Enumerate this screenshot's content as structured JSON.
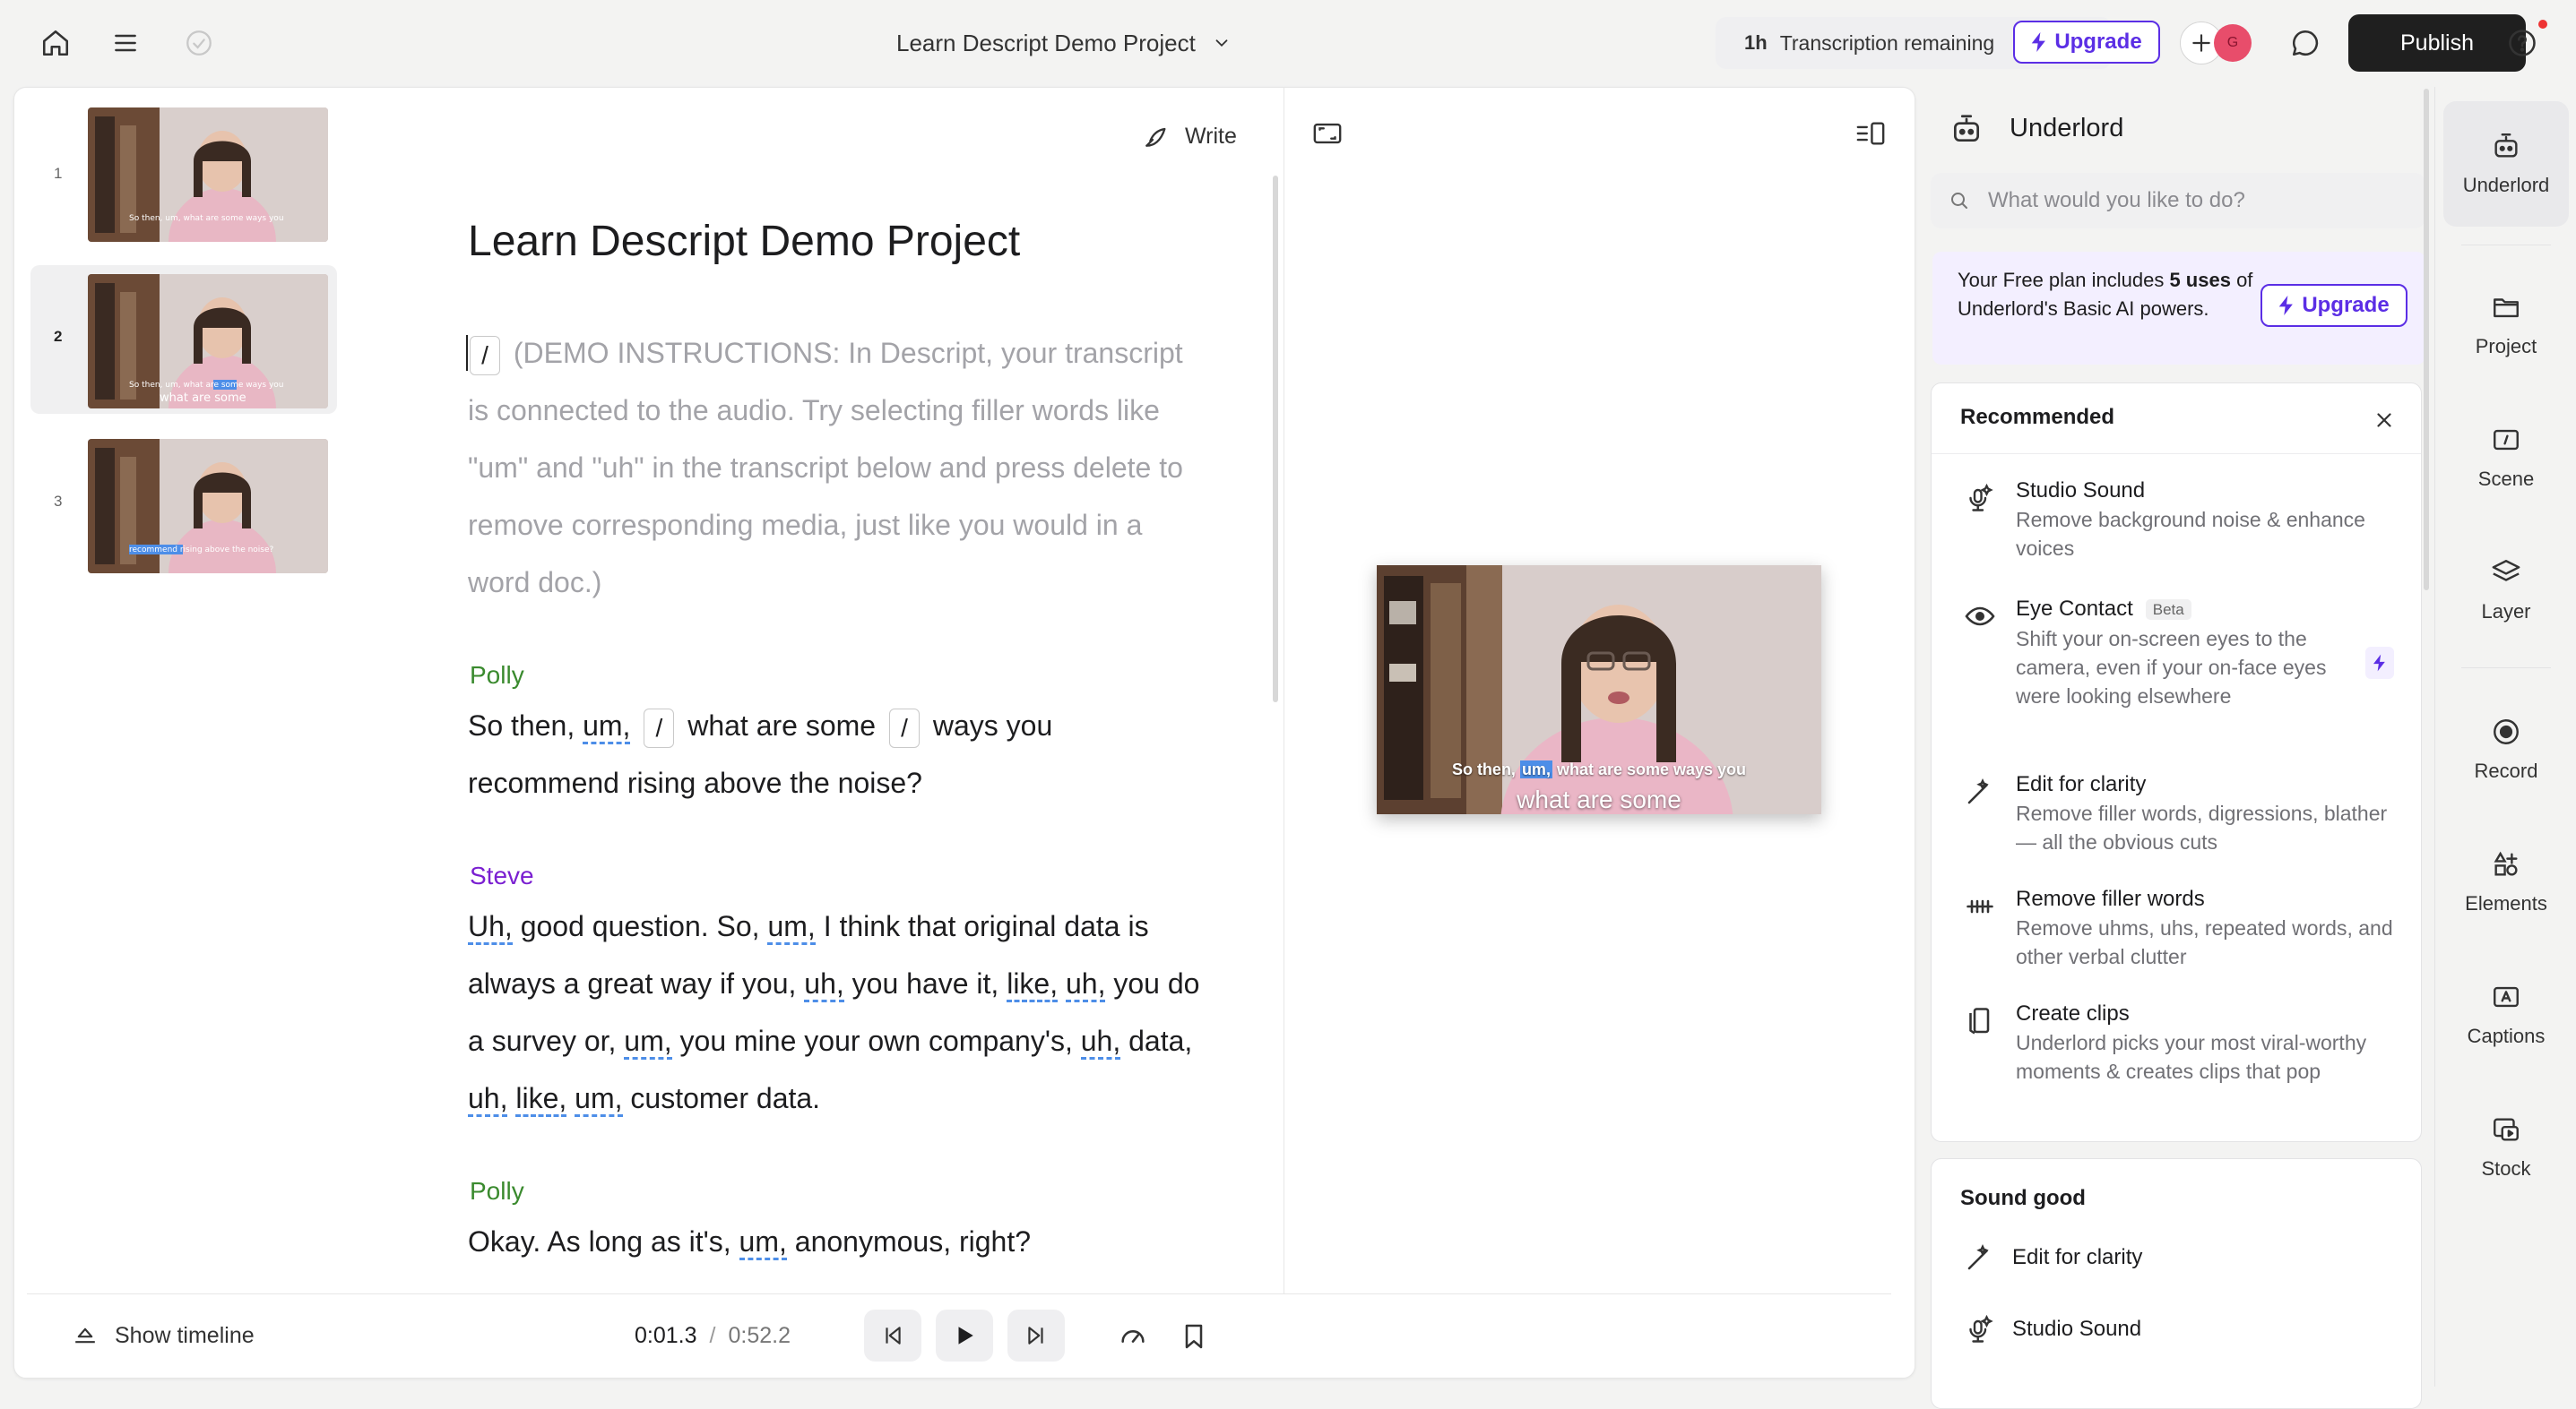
{
  "topbar": {
    "project_title": "Learn Descript Demo Project",
    "transcription_hours": "1h",
    "transcription_text": "Transcription remaining",
    "upgrade_label": "Upgrade",
    "avatar_initial": "G",
    "publish_label": "Publish"
  },
  "scenes": [
    {
      "number": "1"
    },
    {
      "number": "2"
    },
    {
      "number": "3"
    }
  ],
  "editor": {
    "write_label": "Write",
    "doc_title": "Learn Descript Demo Project",
    "gap_symbol": "/",
    "instructions": "(DEMO INSTRUCTIONS: In Descript, your transcript is connected to the audio. Try selecting filler words like \"um\" and \"uh\" in the transcript below and press delete to remove corresponding media, just like you would in a word doc.)",
    "speakers": {
      "polly": "Polly",
      "steve": "Steve"
    },
    "p1": {
      "t1": "So then, ",
      "f1": "um,",
      "t2": "what are some",
      "t3": "ways you recommend rising above the noise?"
    },
    "p2": {
      "f1": "Uh,",
      "t1": " good question. So, ",
      "f2": "um,",
      "t2": " I think that original data is always a great way if you, ",
      "f3": "uh,",
      "t3": " you have it, ",
      "f4": "like,",
      "t4": " ",
      "f5": "uh,",
      "t5": " you do a survey or, ",
      "f6": "um,",
      "t6": " you mine your own company's, ",
      "f7": "uh,",
      "t7": " data, ",
      "f8": "uh,",
      "t8": " ",
      "f9": "like,",
      "t9": " ",
      "f10": "um,",
      "t10": " customer data."
    },
    "p3": {
      "t1": "Okay. As long as it's, ",
      "f1": "um,",
      "t2": " anonymous, right?"
    }
  },
  "preview": {
    "caption_top_1": "So then, ",
    "caption_highlight": "um,",
    "caption_top_2": " what are some ways you",
    "caption_bottom": "what are some"
  },
  "thumb_captions": {
    "t1_a": "So then, ",
    "t1_b": "um,",
    "t1_c": " what are some ways you",
    "t2_a": "So then, um, what are ",
    "t2_b": "some",
    "t2_c": " ways you",
    "t2_d": "what are some",
    "t3_a": "recommend",
    "t3_b": " rising above the noise?"
  },
  "bottombar": {
    "show_timeline": "Show timeline",
    "current_time": "0:01.3",
    "separator": "/",
    "total_time": "0:52.2"
  },
  "underlord": {
    "title": "Underlord",
    "search_placeholder": "What would you like to do?",
    "plan_text_1": "Your Free plan includes ",
    "plan_bold": "5 uses",
    "plan_text_2": " of Underlord's Basic AI powers.",
    "upgrade_label": "Upgrade",
    "recommended_header": "Recommended",
    "recommended": [
      {
        "title": "Studio Sound",
        "desc": "Remove background noise & enhance voices",
        "icon": "studio-sound-icon"
      },
      {
        "title": "Eye Contact",
        "badge": "Beta",
        "desc": "Shift your on-screen eyes to the camera, even if your on-face eyes were looking elsewhere",
        "icon": "eye-icon"
      },
      {
        "title": "Edit for clarity",
        "desc": "Remove filler words, digressions, blather — all the obvious cuts",
        "icon": "magic-wand-icon"
      },
      {
        "title": "Remove filler words",
        "desc": "Remove uhms, uhs, repeated words, and other verbal clutter",
        "icon": "filler-words-icon"
      },
      {
        "title": "Create clips",
        "desc": "Underlord picks your most viral-worthy moments & creates clips that pop",
        "icon": "clips-icon"
      }
    ],
    "sound_good_header": "Sound good",
    "sound_good": [
      {
        "title": "Edit for clarity"
      },
      {
        "title": "Studio Sound"
      }
    ]
  },
  "rail": {
    "items": [
      {
        "label": "Underlord"
      },
      {
        "label": "Project"
      },
      {
        "label": "Scene"
      },
      {
        "label": "Layer"
      },
      {
        "label": "Record"
      },
      {
        "label": "Elements"
      },
      {
        "label": "Captions"
      },
      {
        "label": "Stock"
      }
    ]
  },
  "colors": {
    "accent": "#5b2ee5",
    "polly": "#3a8a2e",
    "steve": "#7a1fd1",
    "filler_underline": "#4d8ee8",
    "publish_bg": "#1f1f1f"
  }
}
